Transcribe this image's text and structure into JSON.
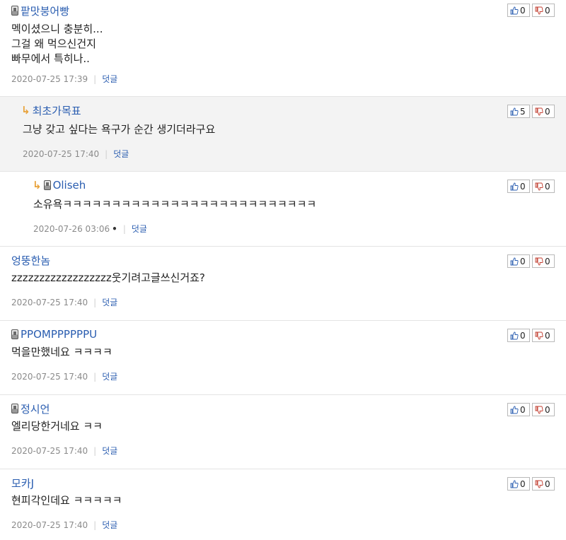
{
  "comments": [
    {
      "author": "팥맛붕어빵",
      "text": "멕이셨으니 충분히...\n그걸 왜 먹으신건지\n빠무에서 특히나..",
      "date": "2020-07-25 17:39",
      "reply_label": "덧글",
      "up": "0",
      "down": "0"
    },
    {
      "author": "최초가목표",
      "text": "그냥 갖고 싶다는 욕구가 순간 생기더라구요",
      "date": "2020-07-25 17:40",
      "reply_label": "덧글",
      "up": "5",
      "down": "0"
    },
    {
      "author": "Oliseh",
      "text": "소유욕ㅋㅋㅋㅋㅋㅋㅋㅋㅋㅋㅋㅋㅋㅋㅋㅋㅋㅋㅋㅋㅋㅋㅋㅋㅋㅋ",
      "date": "2020-07-26 03:06",
      "date_mark": "•",
      "reply_label": "덧글",
      "up": "0",
      "down": "0"
    },
    {
      "author": "엉뚱한놈",
      "text": "zzzzzzzzzzzzzzzzzz웃기려고글쓰신거죠?",
      "date": "2020-07-25 17:40",
      "reply_label": "덧글",
      "up": "0",
      "down": "0"
    },
    {
      "author": "PPOMPPPPPPU",
      "text": "먹을만했네요 ㅋㅋㅋㅋ",
      "date": "2020-07-25 17:40",
      "reply_label": "덧글",
      "up": "0",
      "down": "0"
    },
    {
      "author": "정시언",
      "text": "엘리당한거네요 ㅋㅋ",
      "date": "2020-07-25 17:40",
      "reply_label": "덧글",
      "up": "0",
      "down": "0"
    },
    {
      "author": "모카J",
      "text": "현피각인데요 ㅋㅋㅋㅋㅋ",
      "date": "2020-07-25 17:40",
      "reply_label": "덧글",
      "up": "0",
      "down": "0"
    }
  ],
  "icons": {
    "phone": "mobile-phone-icon",
    "reply_arrow": "reply-arrow-icon",
    "thumbs_up": "thumbs-up-icon",
    "thumbs_down": "thumbs-down-icon"
  },
  "colors": {
    "author": "#2a5db0",
    "reply_bg": "#f3f3f3",
    "reply_arrow": "#e8a23a"
  }
}
